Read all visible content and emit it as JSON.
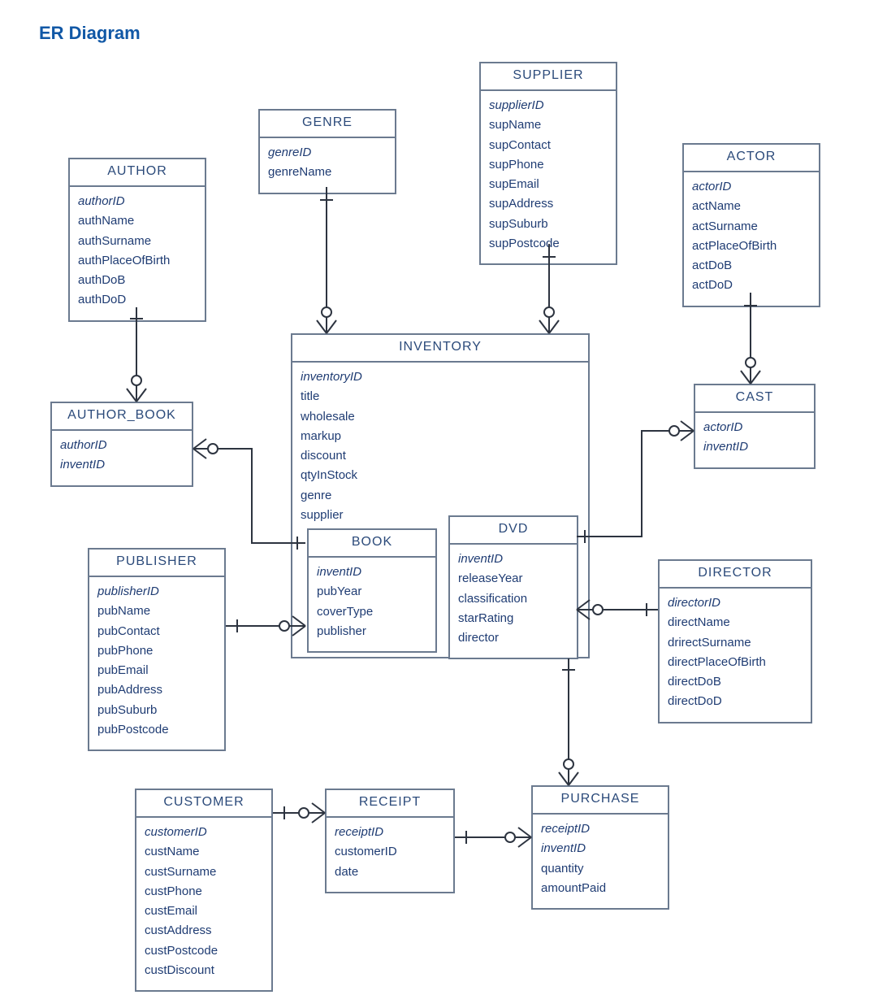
{
  "title": "ER Diagram",
  "entities": {
    "author": {
      "name": "AUTHOR",
      "attrs": [
        "authorID",
        "authName",
        "authSurname",
        "authPlaceOfBirth",
        "authDoB",
        "authDoD"
      ],
      "pk": [
        "authorID"
      ]
    },
    "genre": {
      "name": "GENRE",
      "attrs": [
        "genreID",
        "genreName"
      ],
      "pk": [
        "genreID"
      ]
    },
    "supplier": {
      "name": "SUPPLIER",
      "attrs": [
        "supplierID",
        "supName",
        "supContact",
        "supPhone",
        "supEmail",
        "supAddress",
        "supSuburb",
        "supPostcode"
      ],
      "pk": [
        "supplierID"
      ]
    },
    "actor": {
      "name": "ACTOR",
      "attrs": [
        "actorID",
        "actName",
        "actSurname",
        "actPlaceOfBirth",
        "actDoB",
        "actDoD"
      ],
      "pk": [
        "actorID"
      ]
    },
    "author_book": {
      "name": "AUTHOR_BOOK",
      "attrs": [
        "authorID",
        "inventID"
      ],
      "pk": [
        "authorID",
        "inventID"
      ]
    },
    "inventory": {
      "name": "INVENTORY",
      "attrs": [
        "inventoryID",
        "title",
        "wholesale",
        "markup",
        "discount",
        "qtyInStock",
        "genre",
        "supplier"
      ],
      "pk": [
        "inventoryID"
      ]
    },
    "book": {
      "name": "BOOK",
      "attrs": [
        "inventID",
        "pubYear",
        "coverType",
        "publisher"
      ],
      "pk": [
        "inventID"
      ]
    },
    "dvd": {
      "name": "DVD",
      "attrs": [
        "inventID",
        "releaseYear",
        "classification",
        "starRating",
        "director"
      ],
      "pk": [
        "inventID"
      ]
    },
    "publisher": {
      "name": "PUBLISHER",
      "attrs": [
        "publisherID",
        "pubName",
        "pubContact",
        "pubPhone",
        "pubEmail",
        "pubAddress",
        "pubSuburb",
        "pubPostcode"
      ],
      "pk": [
        "publisherID"
      ]
    },
    "cast": {
      "name": "CAST",
      "attrs": [
        "actorID",
        "inventID"
      ],
      "pk": [
        "actorID",
        "inventID"
      ]
    },
    "director": {
      "name": "DIRECTOR",
      "attrs": [
        "directorID",
        "directName",
        "drirectSurname",
        "directPlaceOfBirth",
        "directDoB",
        "directDoD"
      ],
      "pk": [
        "directorID"
      ]
    },
    "customer": {
      "name": "CUSTOMER",
      "attrs": [
        "customerID",
        "custName",
        "custSurname",
        "custPhone",
        "custEmail",
        "custAddress",
        "custPostcode",
        "custDiscount"
      ],
      "pk": [
        "customerID"
      ]
    },
    "receipt": {
      "name": "RECEIPT",
      "attrs": [
        "receiptID",
        "customerID",
        "date"
      ],
      "pk": [
        "receiptID"
      ]
    },
    "purchase": {
      "name": "PURCHASE",
      "attrs": [
        "receiptID",
        "inventID",
        "quantity",
        "amountPaid"
      ],
      "pk": [
        "receiptID",
        "inventID"
      ]
    }
  },
  "relationships": [
    {
      "from": "author",
      "to": "author_book",
      "card": "1..*"
    },
    {
      "from": "author_book",
      "to": "inventory",
      "card": "*..1",
      "via": "book"
    },
    {
      "from": "genre",
      "to": "inventory",
      "card": "1..*"
    },
    {
      "from": "supplier",
      "to": "inventory",
      "card": "1..*"
    },
    {
      "from": "actor",
      "to": "cast",
      "card": "1..*"
    },
    {
      "from": "cast",
      "to": "dvd",
      "card": "*..1"
    },
    {
      "from": "director",
      "to": "dvd",
      "card": "1..*"
    },
    {
      "from": "publisher",
      "to": "book",
      "card": "1..*"
    },
    {
      "from": "inventory",
      "to": "purchase",
      "card": "1..*"
    },
    {
      "from": "receipt",
      "to": "purchase",
      "card": "1..*"
    },
    {
      "from": "customer",
      "to": "receipt",
      "card": "1..*"
    }
  ]
}
